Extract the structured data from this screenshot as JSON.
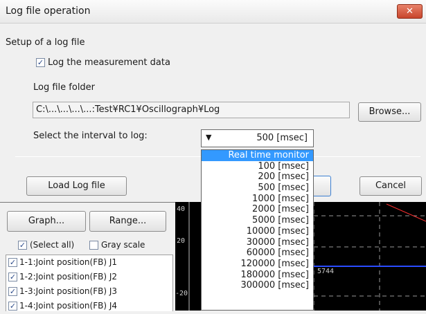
{
  "window": {
    "title": "Log file operation",
    "close_glyph": "✕"
  },
  "setup": {
    "section_label": "Setup of a log file",
    "log_checkbox_label": "Log the measurement data",
    "log_checked": true,
    "folder_label": "Log file folder",
    "folder_path": "C:\\...\\...\\...\\...:Test¥RC1¥Oscillograph¥Log",
    "browse_label": "Browse...",
    "interval_label": "Select the interval to log:",
    "interval_value": "500 [msec]"
  },
  "buttons": {
    "load_log": "Load Log file",
    "cancel": "Cancel"
  },
  "dropdown": {
    "options": [
      "Real time monitor",
      "100 [msec]",
      "200 [msec]",
      "500 [msec]",
      "1000 [msec]",
      "2000 [msec]",
      "5000 [msec]",
      "10000 [msec]",
      "30000 [msec]",
      "60000 [msec]",
      "120000 [msec]",
      "180000 [msec]",
      "300000 [msec]"
    ],
    "highlighted_index": 0
  },
  "panel": {
    "graph_button": "Graph...",
    "range_button": "Range...",
    "select_all_label": "(Select all)",
    "select_all_checked": true,
    "gray_scale_label": "Gray scale",
    "gray_scale_checked": false,
    "channels": [
      {
        "label": "1-1:Joint position(FB) J1",
        "checked": true
      },
      {
        "label": "1-2:Joint position(FB) J2",
        "checked": true
      },
      {
        "label": "1-3:Joint position(FB) J3",
        "checked": true
      },
      {
        "label": "1-4:Joint position(FB) J4",
        "checked": true
      }
    ]
  },
  "graph": {
    "y_ticks": [
      "40",
      "20",
      "-20"
    ],
    "readout": "5744",
    "colors": {
      "blue_trace": "#2a4cff",
      "red_trace": "#ff3030",
      "grid": "#9a9a9a"
    }
  }
}
